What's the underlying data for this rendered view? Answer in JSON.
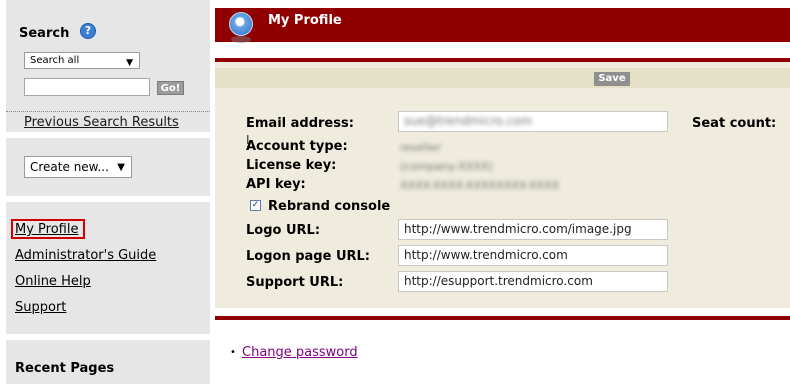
{
  "sidebar": {
    "search": {
      "title": "Search",
      "help_icon": "?",
      "scope_selected": "Search all",
      "query_value": "",
      "go_label": "Go!",
      "previous_results": "Previous Search Results"
    },
    "create_new_label": "Create new...",
    "links": {
      "my_profile": "My Profile",
      "admin_guide": "Administrator's Guide",
      "online_help": "Online Help",
      "support": "Support"
    },
    "recent_pages_title": "Recent Pages"
  },
  "header": {
    "title": "My Profile",
    "icon": "profile-globe-icon"
  },
  "form": {
    "save_label": "Save",
    "email_label": "Email address:",
    "email_value": "sue@trendmicro.com",
    "seat_count_label": "Seat count:",
    "account_type_label": "Account type:",
    "account_type_value": "reseller",
    "license_key_label": "License key:",
    "license_key_value": "(company-XXXX)",
    "api_key_label": "API key:",
    "api_key_value": "XXXX-XXXX-XXXXXXXX-XXXX",
    "rebrand_label": "Rebrand console",
    "rebrand_checked": "✓",
    "logo_url_label": "Logo URL:",
    "logo_url_value": "http://www.trendmicro.com/image.jpg",
    "logon_page_url_label": "Logon page URL:",
    "logon_page_url_value": "http://www.trendmicro.com",
    "support_url_label": "Support URL:",
    "support_url_value": "http://esupport.trendmicro.com"
  },
  "actions": {
    "change_password": "Change password"
  },
  "colors": {
    "brand": "#900000",
    "panel": "#efecdd",
    "sidebar": "#e6e6e6",
    "highlight_box": "#d00000"
  }
}
